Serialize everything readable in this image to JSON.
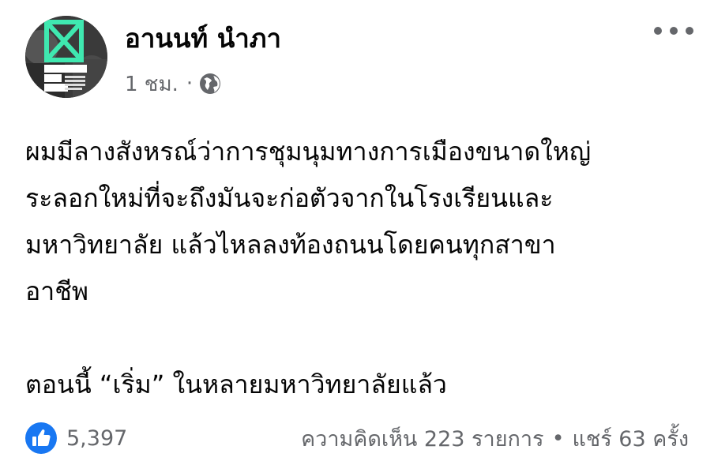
{
  "post": {
    "author": "อานนท์ นำภา",
    "time": "1 ชม.",
    "time_separator": "·",
    "audience_icon": "globe-icon",
    "avatar": {
      "badge_line1": "Respect",
      "badge_line2": "My",
      "badge_line3": "Vote",
      "accent_color": "#3fe8b0"
    },
    "paragraphs": [
      "ผมมีลางสังหรณ์ว่าการชุมนุมทางการเมืองขนาดใหญ่\nระลอกใหม่ที่จะถึงมันจะก่อตัวจากในโรงเรียนและ\nมหาวิทยาลัย แล้วไหลลงท้องถนนโดยคนทุกสาขา\nอาชีพ",
      "ตอนนี้ “เริ่ม” ในหลายมหาวิทยาลัยแล้ว"
    ],
    "footer": {
      "reaction_icon": "like-icon",
      "reaction_count": "5,397",
      "comments": "ความคิดเห็น 223 รายการ",
      "separator": "•",
      "shares": "แชร์ 63 ครั้ง"
    }
  },
  "colors": {
    "text_primary": "#050505",
    "text_secondary": "#65676b",
    "like_blue": "#1877f2"
  }
}
